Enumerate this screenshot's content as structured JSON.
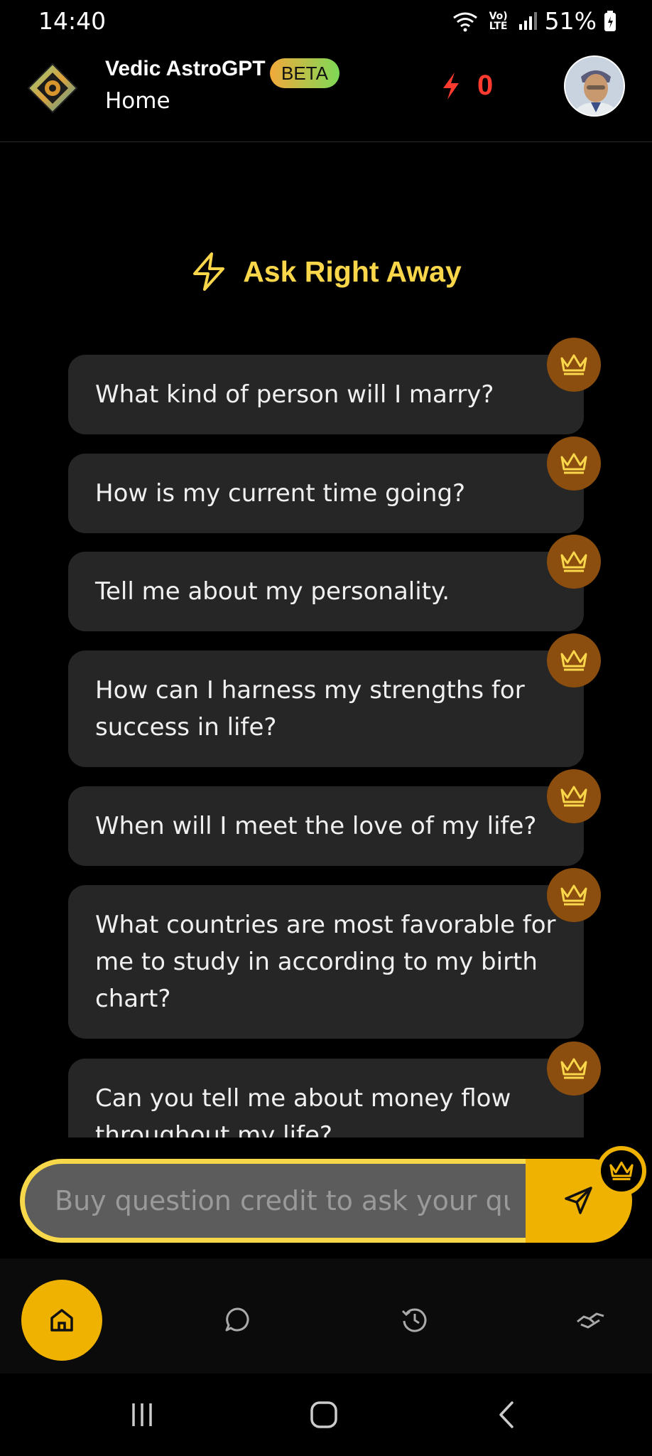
{
  "status_bar": {
    "time": "14:40",
    "battery": "51%",
    "network_label": "Vo) LTE"
  },
  "header": {
    "app_name": "Vedic AstroGPT",
    "badge": "BETA",
    "subtitle": "Home",
    "credits": "0"
  },
  "section": {
    "title": "Ask Right Away"
  },
  "suggestions": [
    {
      "text": "What kind of person will I marry?"
    },
    {
      "text": "How is my current time going?"
    },
    {
      "text": "Tell me about my personality."
    },
    {
      "text": "How can I harness my strengths for success in life?"
    },
    {
      "text": "When will I meet the love of my life?"
    },
    {
      "text": "What countries are most favorable for me to study in according to my birth chart?"
    },
    {
      "text": "Can you tell me about money flow throughout my life?"
    }
  ],
  "input": {
    "placeholder": "Buy question credit to ask your question"
  },
  "icons": {
    "logo": "app-logo-icon",
    "credit": "lightning-icon",
    "premium": "crown-icon",
    "send": "send-icon",
    "home": "home-icon",
    "chat": "chat-icon",
    "history": "history-icon",
    "handshake": "handshake-icon"
  },
  "colors": {
    "accent": "#f0b200",
    "title": "#f9d64a",
    "credit": "#ff3b30",
    "card": "#262626",
    "crown_bg": "#8b4e0e"
  }
}
